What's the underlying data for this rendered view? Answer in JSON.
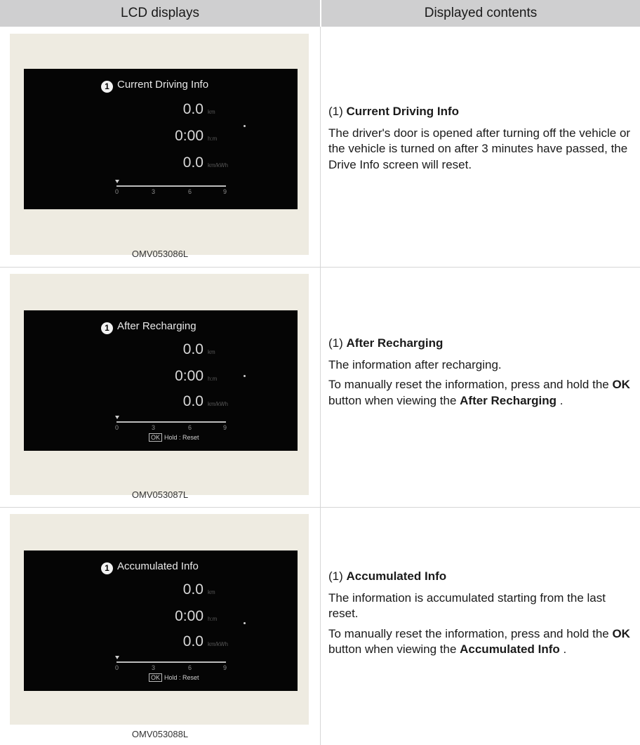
{
  "header": {
    "col_lcd": "LCD displays",
    "col_contents": "Displayed contents"
  },
  "rows": [
    {
      "lcd": {
        "badge": "1",
        "title": "Current Driving Info",
        "values": [
          "0.0",
          "0:00",
          "0.0"
        ],
        "units": [
          "km",
          "h:m",
          "km/kWh"
        ],
        "scale": [
          "0",
          "3",
          "6",
          "9"
        ]
      },
      "code": "OMV053086L",
      "desc": {
        "num": "(1)",
        "title": "Current Driving Info",
        "body": "The driver's door is opened after turning off the vehicle or the vehicle is turned on after 3 minutes have passed, the Drive Info screen will reset."
      }
    },
    {
      "lcd": {
        "badge": "1",
        "title": "After Recharging",
        "values": [
          "0.0",
          "0:00",
          "0.0"
        ],
        "units": [
          "km",
          "h:m",
          "km/kWh"
        ],
        "scale": [
          "0",
          "3",
          "6",
          "9"
        ],
        "ok": "OK",
        "hold": "Hold : Reset"
      },
      "code": "OMV053087L",
      "desc": {
        "num": "(1)",
        "title": "After Recharging",
        "line1": "The information after recharging.",
        "line2a": "To manually reset the information, press and hold the ",
        "ok": "OK",
        "line2b": " button when viewing the ",
        "ref": "After Recharging",
        "end": " ."
      }
    },
    {
      "lcd": {
        "badge": "1",
        "title": "Accumulated Info",
        "values": [
          "0.0",
          "0:00",
          "0.0"
        ],
        "units": [
          "km",
          "h:m",
          "km/kWh"
        ],
        "scale": [
          "0",
          "3",
          "6",
          "9"
        ],
        "ok": "OK",
        "hold": "Hold : Reset"
      },
      "code": "OMV053088L",
      "desc": {
        "num": "(1)",
        "title": "Accumulated Info",
        "line1": "The information is accumulated starting from the last reset.",
        "line2a": "To manually reset the information, press and hold the ",
        "ok": "OK",
        "line2b": " button when viewing the ",
        "ref": "Accumulated Info",
        "end": " ."
      }
    }
  ]
}
